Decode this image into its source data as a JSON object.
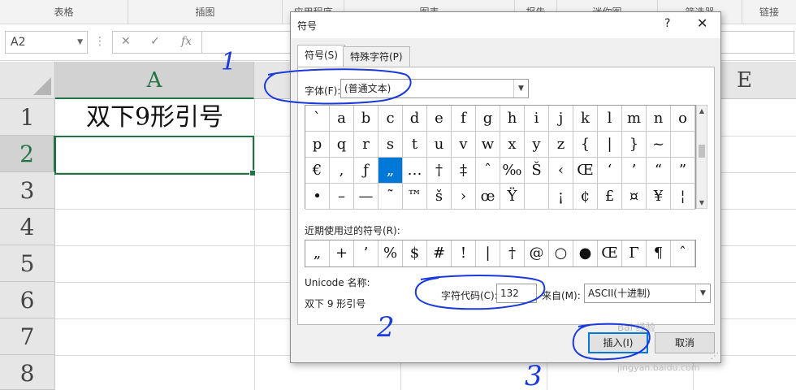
{
  "ribbon": {
    "groups": [
      "表格",
      "插图",
      "应用程序",
      "图表",
      "报告",
      "迷你图",
      "筛选器",
      "链接"
    ]
  },
  "formula_bar": {
    "name_box": "A2",
    "cancel_icon": "✕",
    "enter_icon": "✓",
    "fx_icon": "fx"
  },
  "sheet": {
    "columns": [
      "A",
      "E"
    ],
    "selected_column": "A",
    "rows": [
      "1",
      "2",
      "3",
      "4",
      "5",
      "6",
      "7",
      "8"
    ],
    "selected_row": "2",
    "cell_a1": "双下9形引号"
  },
  "dialog": {
    "title": "符号",
    "help": "?",
    "close": "✕",
    "tabs": [
      "符号(S)",
      "特殊字符(P)"
    ],
    "font_label": "字体(F):",
    "font_value": "(普通文本)",
    "symbols": [
      [
        "`",
        "a",
        "b",
        "c",
        "d",
        "e",
        "f",
        "g",
        "h",
        "i",
        "j",
        "k",
        "l",
        "m",
        "n",
        "o"
      ],
      [
        "p",
        "q",
        "r",
        "s",
        "t",
        "u",
        "v",
        "w",
        "x",
        "y",
        "z",
        "{",
        "|",
        "}",
        "~",
        ""
      ],
      [
        "€",
        ",",
        "ƒ",
        "„",
        "…",
        "†",
        "‡",
        "ˆ",
        "‰",
        "Š",
        "‹",
        "Œ",
        "‘",
        "’",
        "“",
        "”"
      ],
      [
        "•",
        "–",
        "—",
        "˜",
        "™",
        "š",
        "›",
        "œ",
        "Ÿ",
        "",
        "¡",
        "¢",
        "£",
        "¤",
        "¥",
        "¦"
      ]
    ],
    "selected_symbol": "„",
    "recent_label": "近期使用过的符号(R):",
    "recent": [
      "„",
      "+",
      "’",
      "%",
      "$",
      "#",
      "!",
      "|",
      "†",
      "@",
      "○",
      "●",
      "Œ",
      "Γ",
      "¶",
      "ˆ"
    ],
    "unicode_label": "Unicode 名称:",
    "unicode_name": "双下 9 形引号",
    "code_label": "字符代码(C):",
    "code_value": "132",
    "from_label": "来自(M):",
    "from_value": "ASCII(十进制)",
    "insert_label": "插入(I)",
    "cancel_label": "取消"
  },
  "annotations": [
    "1",
    "2",
    "3"
  ],
  "watermark": "Bai 经验",
  "watermark_url": "jingyan.baidu.com"
}
